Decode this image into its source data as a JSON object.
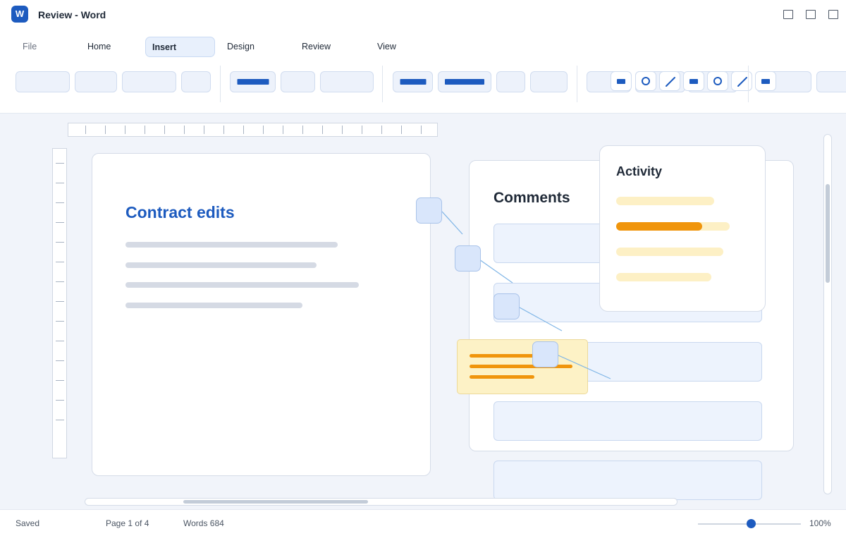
{
  "window": {
    "app_icon_letter": "W",
    "title": "Review - Word"
  },
  "tabs": [
    {
      "label": "File"
    },
    {
      "label": "Home"
    },
    {
      "label": "Insert"
    },
    {
      "label": "Design"
    },
    {
      "label": "Review"
    },
    {
      "label": "View"
    }
  ],
  "ribbon": {
    "active_tab": "Insert",
    "accent_color": "#1d5bbf"
  },
  "document": {
    "heading": "Contract edits"
  },
  "comments_panel": {
    "title": "Comments"
  },
  "activity_panel": {
    "title": "Activity",
    "highlighted_fill_fraction": 0.76,
    "accent_color": "#f0950c"
  },
  "status": {
    "save_state": "Saved",
    "page_info": "Page 1 of 4",
    "word_count": "Words 684",
    "zoom_label": "100%",
    "zoom_slider_value": 0.52
  }
}
